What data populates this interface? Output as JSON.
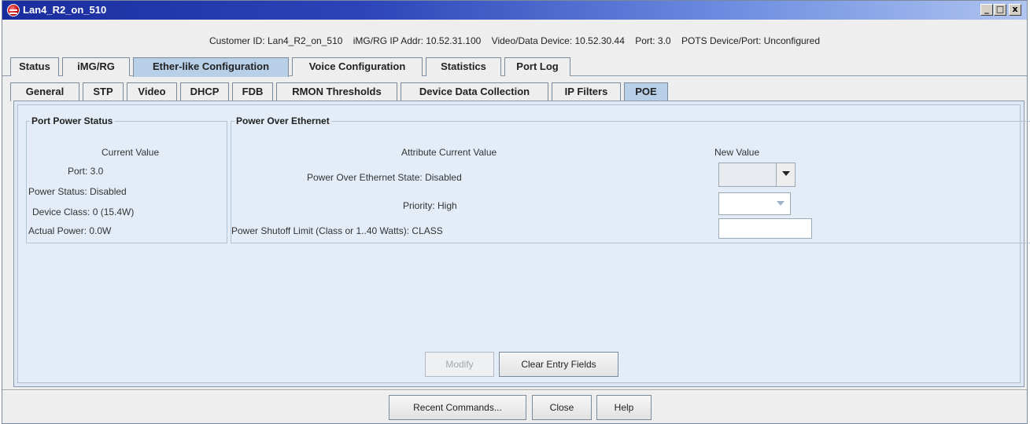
{
  "window": {
    "title": "Lan4_R2_on_510",
    "min_glyph": "_",
    "max_glyph": "□",
    "close_glyph": "x"
  },
  "info": {
    "customer_id": "Customer ID: Lan4_R2_on_510",
    "img_rg_ip": "iMG/RG IP Addr: 10.52.31.100",
    "video_device": "Video/Data Device: 10.52.30.44",
    "port": "Port: 3.0",
    "pots": "POTS Device/Port: Unconfigured"
  },
  "tabs_main": [
    {
      "label": "Status"
    },
    {
      "label": "iMG/RG"
    },
    {
      "label": "Ether-like Configuration"
    },
    {
      "label": "Voice Configuration"
    },
    {
      "label": "Statistics"
    },
    {
      "label": "Port Log"
    }
  ],
  "tabs_sub": [
    {
      "label": "General"
    },
    {
      "label": "STP"
    },
    {
      "label": "Video"
    },
    {
      "label": "DHCP"
    },
    {
      "label": "FDB"
    },
    {
      "label": "RMON Thresholds"
    },
    {
      "label": "Device Data Collection"
    },
    {
      "label": "IP Filters"
    },
    {
      "label": "POE"
    }
  ],
  "port_power_status": {
    "legend": "Port Power Status",
    "header": "Current Value",
    "port": "Port: 3.0",
    "power_status": "Power Status: Disabled",
    "device_class": "Device Class: 0 (15.4W)",
    "actual_power": "Actual Power: 0.0W"
  },
  "poe": {
    "legend": "Power Over Ethernet",
    "header_attr": "Attribute Current Value",
    "header_new": "New Value",
    "state": "Power Over Ethernet State: Disabled",
    "priority": "Priority: High",
    "shutoff": "Power Shutoff Limit (Class or 1..40 Watts): CLASS",
    "shutoff_value": ""
  },
  "buttons": {
    "modify": "Modify",
    "clear": "Clear Entry Fields",
    "recent": "Recent Commands...",
    "close": "Close",
    "help": "Help"
  }
}
